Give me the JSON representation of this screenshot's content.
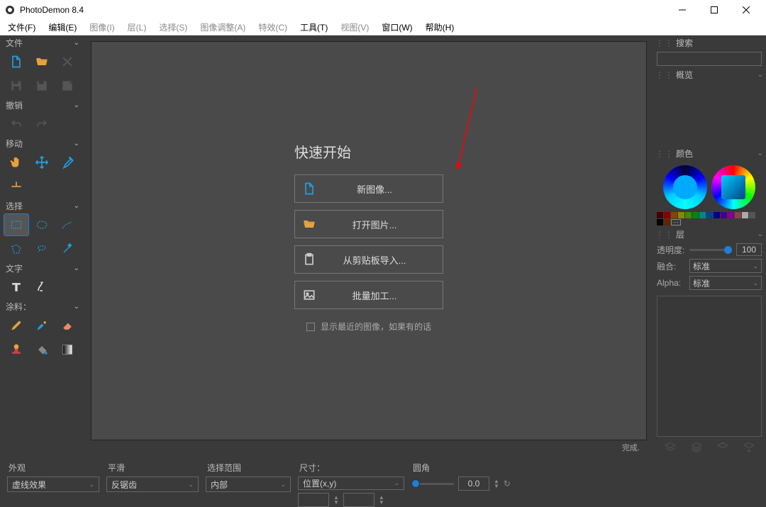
{
  "title": "PhotoDemon 8.4",
  "menu": [
    "文件(F)",
    "编辑(E)",
    "图像(I)",
    "层(L)",
    "选择(S)",
    "图像调整(A)",
    "特效(C)",
    "工具(T)",
    "视图(V)",
    "窗口(W)",
    "帮助(H)"
  ],
  "left": {
    "file": "文件",
    "undo": "撤销",
    "move": "移动",
    "select": "选择",
    "text": "文字",
    "paint": "涂料："
  },
  "quickstart": {
    "title": "快速开始",
    "btns": [
      {
        "label": "新图像..."
      },
      {
        "label": "打开图片..."
      },
      {
        "label": "从剪贴板导入..."
      },
      {
        "label": "批量加工..."
      }
    ],
    "check": "显示最近的图像，如果有的话"
  },
  "right": {
    "search": "搜索",
    "overview": "概览",
    "color": "颜色",
    "layer": "层",
    "opacity_label": "透明度:",
    "opacity": "100",
    "blend_label": "融合:",
    "blend": "标准",
    "alpha_label": "Alpha:",
    "alpha": "标准"
  },
  "status": "完成.",
  "bottom": {
    "appearance": {
      "label": "外观",
      "value": "虚线效果"
    },
    "smooth": {
      "label": "平滑",
      "value": "反锯齿"
    },
    "range": {
      "label": "选择范围",
      "value": "内部"
    },
    "size": {
      "label": "尺寸：",
      "value": "位置(x,y)"
    },
    "corner": {
      "label": "圆角",
      "value": "0.0"
    }
  },
  "swatch_colors": [
    "#400",
    "#800",
    "#840",
    "#880",
    "#480",
    "#080",
    "#088",
    "#048",
    "#008",
    "#408",
    "#808",
    "#844",
    "#aaa",
    "#555",
    "#000",
    "#620"
  ]
}
